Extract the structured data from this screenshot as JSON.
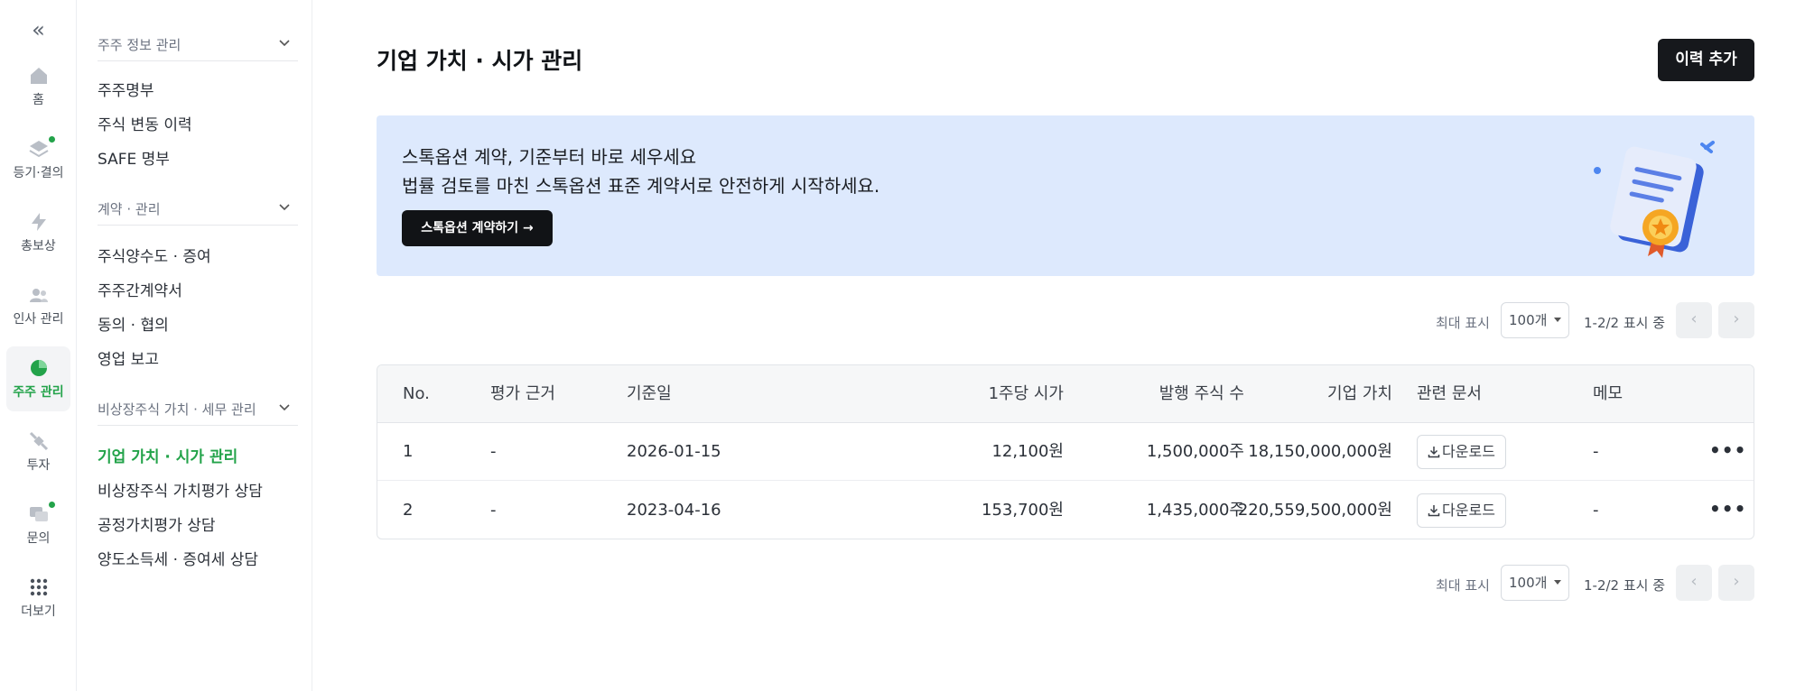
{
  "rail": {
    "collapse_glyph": "«",
    "items": [
      {
        "label": "홈",
        "icon": "home-icon",
        "dot": false,
        "active": false
      },
      {
        "label": "등기·결의",
        "icon": "layers-icon",
        "dot": true,
        "active": false
      },
      {
        "label": "총보상",
        "icon": "bolt-icon",
        "dot": false,
        "active": false
      },
      {
        "label": "인사 관리",
        "icon": "people-icon",
        "dot": false,
        "active": false
      },
      {
        "label": "주주 관리",
        "icon": "pie-icon",
        "dot": false,
        "active": true
      },
      {
        "label": "투자",
        "icon": "satellite-icon",
        "dot": false,
        "active": false
      },
      {
        "label": "문의",
        "icon": "chat-icon",
        "dot": true,
        "active": false
      },
      {
        "label": "더보기",
        "icon": "grid-icon",
        "dot": false,
        "active": false
      }
    ]
  },
  "submenu": {
    "sections": [
      {
        "title": "주주 정보 관리",
        "items": [
          "주주명부",
          "주식 변동 이력",
          "SAFE 명부"
        ]
      },
      {
        "title": "계약 · 관리",
        "items": [
          "주식양수도 · 증여",
          "주주간계약서",
          "동의 · 협의",
          "영업 보고"
        ]
      },
      {
        "title": "비상장주식 가치 · 세무 관리",
        "items": [
          "기업 가치 · 시가 관리",
          "비상장주식 가치평가 상담",
          "공정가치평가 상담",
          "양도소득세 · 증여세 상담"
        ]
      }
    ],
    "active_item": "기업 가치 · 시가 관리"
  },
  "main": {
    "title": "기업 가치 · 시가 관리",
    "add_button": "이력 추가",
    "banner": {
      "title": "스톡옵션 계약, 기준부터 바로 세우세요",
      "subtitle": "법률 검토를 마친 스톡옵션 표준 계약서로 안전하게 시작하세요.",
      "button": "스톡옵션 계약하기 →",
      "art_icon": "certificate-icon"
    },
    "pager": {
      "max_label": "최대 표시",
      "page_size": "100개",
      "count": "1-2/2 표시 중",
      "prev": "‹",
      "next": "›"
    },
    "table": {
      "columns": [
        "No.",
        "평가 근거",
        "기준일",
        "1주당 시가",
        "발행 주식 수",
        "기업 가치",
        "관련 문서",
        "메모"
      ],
      "download_label": "다운로드",
      "more_glyph": "•••",
      "rows": [
        {
          "no": "1",
          "basis": "-",
          "date": "2026-01-15",
          "price": "12,100원",
          "shares": "1,500,000주",
          "value": "18,150,000,000원",
          "memo": "-"
        },
        {
          "no": "2",
          "basis": "-",
          "date": "2023-04-16",
          "price": "153,700원",
          "shares": "1,435,000주",
          "value": "220,559,500,000원",
          "memo": "-"
        }
      ]
    }
  },
  "colors": {
    "accent": "#23a34a",
    "banner_bg": "#dde9fd",
    "primary_btn": "#16181c"
  }
}
